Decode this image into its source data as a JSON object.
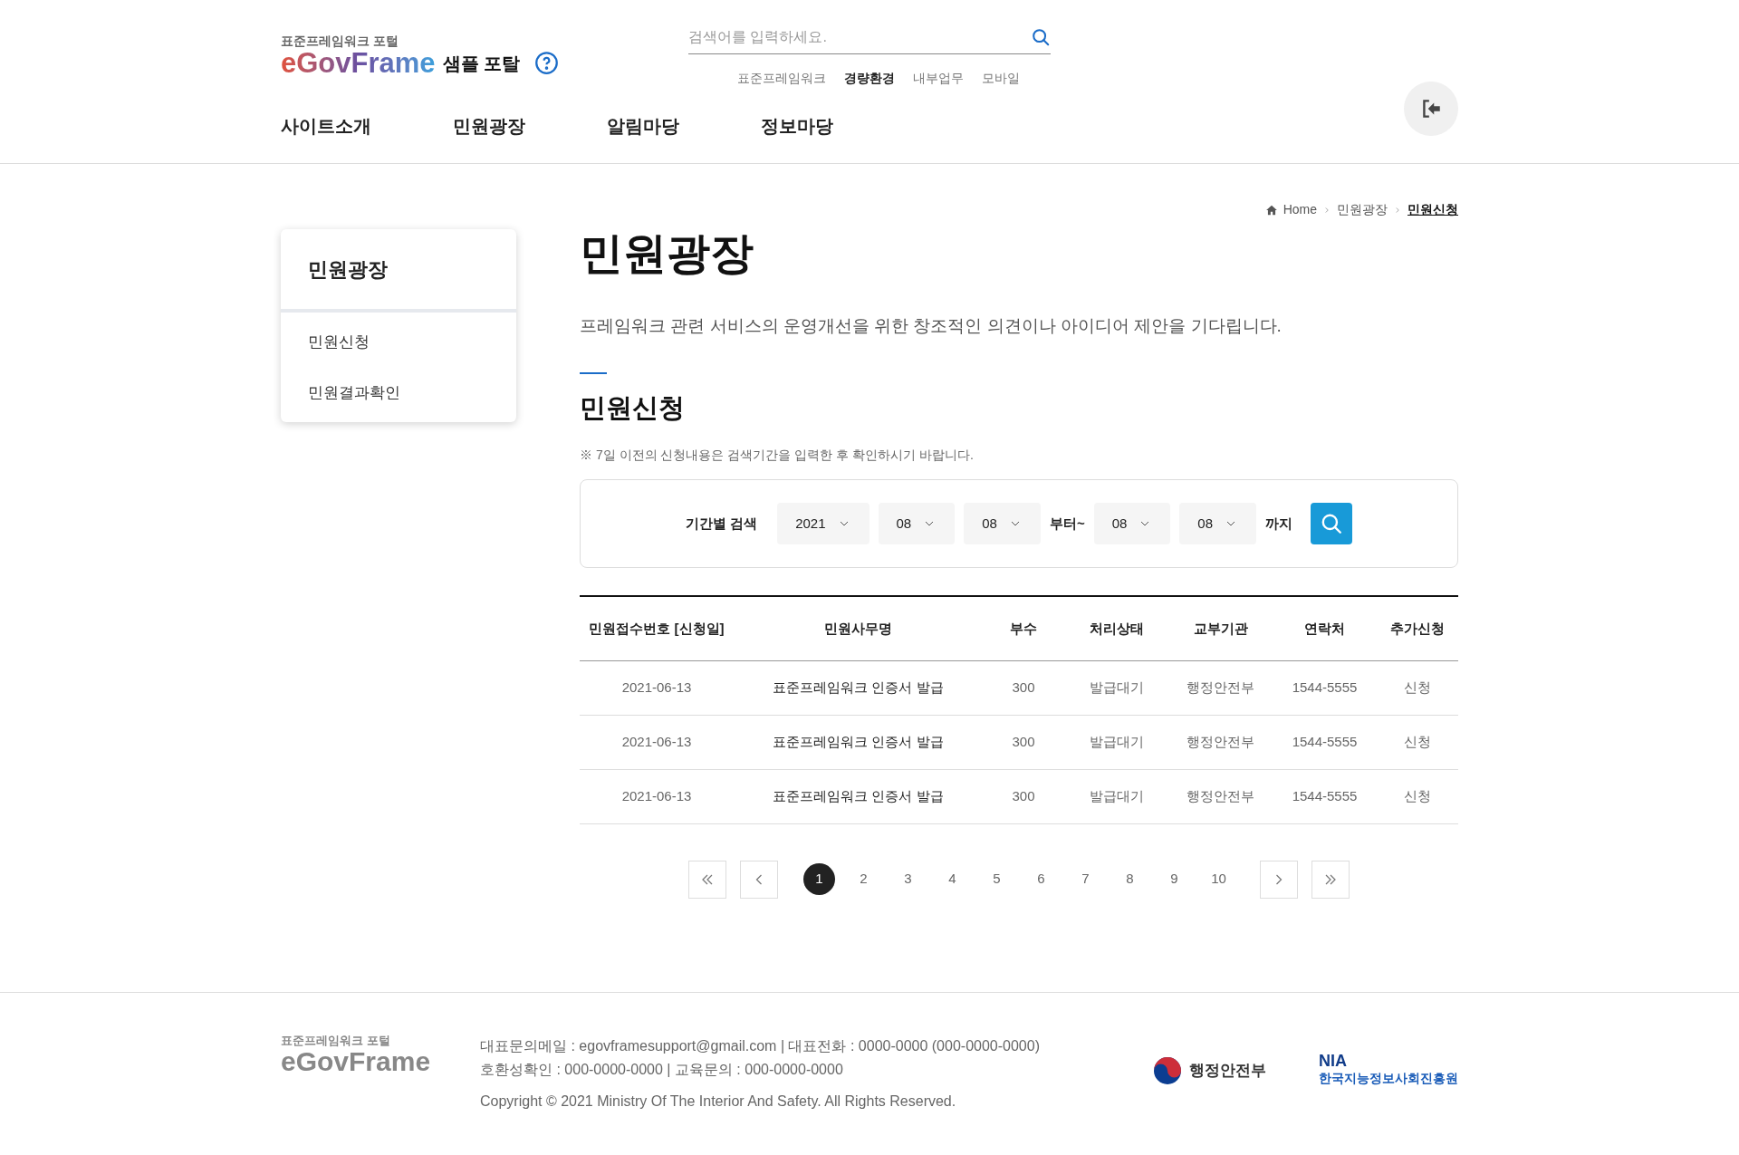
{
  "header": {
    "logo": {
      "subtitle": "표준프레임워크 **포털**",
      "brand": "eGovFrame",
      "suffix": "샘플 포탈"
    },
    "search": {
      "placeholder": "검색어를 입력하세요."
    },
    "quick_links": [
      {
        "label": "표준프레임워크",
        "selected": false
      },
      {
        "label": "경량환경",
        "selected": true
      },
      {
        "label": "내부업무",
        "selected": false
      },
      {
        "label": "모바일",
        "selected": false
      }
    ],
    "nav": [
      "사이트소개",
      "민원광장",
      "알림마당",
      "정보마당"
    ]
  },
  "breadcrumb": [
    {
      "label": "Home",
      "selected": false
    },
    {
      "label": "민원광장",
      "selected": false
    },
    {
      "label": "민원신청",
      "selected": true
    }
  ],
  "sidebar": {
    "title": "민원광장",
    "items": [
      {
        "label": "민원신청",
        "selected": false
      },
      {
        "label": "민원결과확인",
        "selected": false
      }
    ]
  },
  "page": {
    "title": "민원광장",
    "description": "프레임워크 관련 서비스의 운영개선을 위한 창조적인 의견이나 아이디어 제안을 기다립니다.",
    "section_title": "민원신청",
    "note": "※ 7일 이전의 신청내용은 검색기간을 입력한 후 확인하시기 바랍니다."
  },
  "filter": {
    "label": "기간별 검색",
    "items": [
      {
        "kind": "select",
        "value": "2021"
      },
      {
        "kind": "select",
        "value": "08"
      },
      {
        "kind": "select",
        "value": "08"
      },
      {
        "kind": "text",
        "value": "부터~"
      },
      {
        "kind": "select",
        "value": "08"
      },
      {
        "kind": "select",
        "value": "08"
      },
      {
        "kind": "text",
        "value": "까지"
      }
    ]
  },
  "table": {
    "columns": [
      "민원접수번호 [신청일]",
      "민원사무명",
      "부수",
      "처리상태",
      "교부기관",
      "연락처",
      "추가신청"
    ],
    "rows": [
      [
        "2021-06-13",
        "표준프레임워크 인증서 발급",
        "300",
        "발급대기",
        "행정안전부",
        "1544-5555",
        "신청"
      ],
      [
        "2021-06-13",
        "표준프레임워크 인증서 발급",
        "300",
        "발급대기",
        "행정안전부",
        "1544-5555",
        "신청"
      ],
      [
        "2021-06-13",
        "표준프레임워크 인증서 발급",
        "300",
        "발급대기",
        "행정안전부",
        "1544-5555",
        "신청"
      ]
    ]
  },
  "pagination": [
    {
      "label": "1",
      "selected": true
    },
    {
      "label": "2",
      "selected": false
    },
    {
      "label": "3",
      "selected": false
    },
    {
      "label": "4",
      "selected": false
    },
    {
      "label": "5",
      "selected": false
    },
    {
      "label": "6",
      "selected": false
    },
    {
      "label": "7",
      "selected": false
    },
    {
      "label": "8",
      "selected": false
    },
    {
      "label": "9",
      "selected": false
    },
    {
      "label": "10",
      "selected": false
    }
  ],
  "footer": {
    "logo_subtitle": "표준프레임워크 포털",
    "logo_brand": "eGovFrame",
    "lines": [
      "대표문의메일 : egovframesupport@gmail.com | 대표전화 : 0000-0000 (000-0000-0000)",
      "호환성확인 : 000-0000-0000 | 교육문의 : 000-0000-0000"
    ],
    "copyright": "Copyright © 2021 Ministry Of The Interior And Safety. All Rights Reserved.",
    "ministry": "행정안전부",
    "nia_title": "NIA",
    "nia_name": "한국지능정보사회진흥원"
  }
}
